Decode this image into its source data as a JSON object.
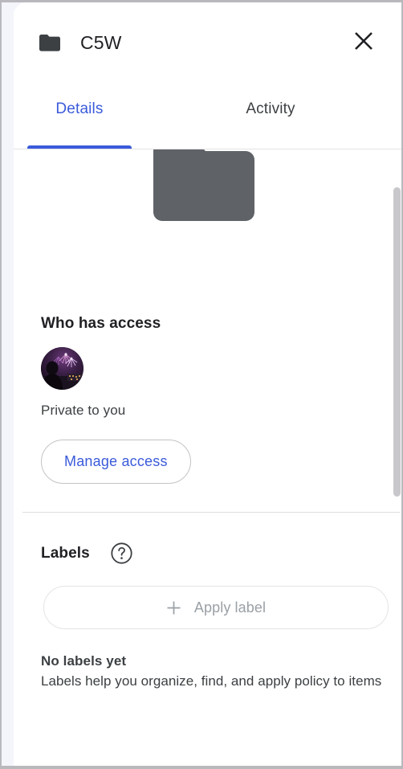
{
  "window": {
    "background_color": "#f4f5fb",
    "border_color": "#b9b9bd"
  },
  "header": {
    "icon": "folder-icon",
    "title": "C5W",
    "close_icon": "close-icon"
  },
  "tabs": {
    "items": [
      {
        "label": "Details",
        "active": true
      },
      {
        "label": "Activity",
        "active": false
      }
    ],
    "active_color": "#3b5bdb",
    "inactive_color": "#3c4043"
  },
  "preview": {
    "icon": "folder-preview-icon",
    "color": "#5f6368"
  },
  "who_has_access": {
    "heading": "Who has access",
    "avatar": "user-avatar-fireworks",
    "status": "Private to you",
    "manage_button_label": "Manage access"
  },
  "labels": {
    "heading": "Labels",
    "help_icon": "help-circle-icon",
    "apply_button_label": "Apply label",
    "apply_button_icon": "plus-icon",
    "empty_title": "No labels yet",
    "empty_description": "Labels help you organize, find, and apply policy to items"
  },
  "scrollbar": {
    "thumb_color": "#c8c8cc"
  }
}
